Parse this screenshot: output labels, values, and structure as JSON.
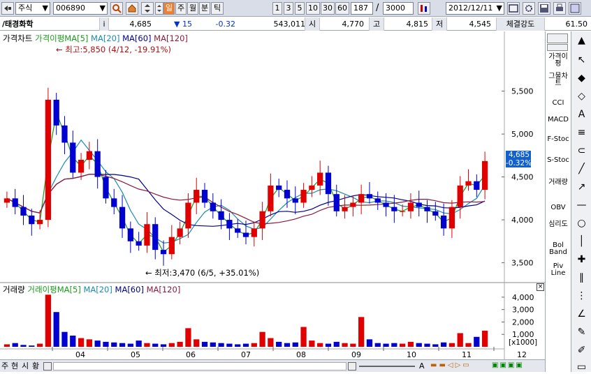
{
  "toolbar": {
    "market_select": "주식",
    "code_input": "006890",
    "period_buttons": [
      "일",
      "주",
      "월",
      "분",
      "틱"
    ],
    "interval_buttons": [
      "1",
      "3",
      "5",
      "10",
      "30",
      "60"
    ],
    "view_count": "187",
    "total_count": "3000",
    "date_input": "2012/12/11",
    "slash": "/"
  },
  "info": {
    "name": "/태경화학",
    "info_tag": "i",
    "price": "4,685",
    "change": "▼ 15",
    "change_pct": "-0.32",
    "volume": "543,011",
    "open_label": "시",
    "open": "4,770",
    "high_label": "고",
    "high": "4,815",
    "low_label": "저",
    "low": "4,545",
    "strength_label": "체결강도",
    "strength": "61.50"
  },
  "price_legend": {
    "prefix": "가격차트",
    "items": [
      {
        "name": "가격이평MA[5]",
        "color": "#1a9a1a"
      },
      {
        "name": "MA[20]",
        "color": "#1a8ab0"
      },
      {
        "name": "MA[60]",
        "color": "#00008b"
      },
      {
        "name": "MA[120]",
        "color": "#8b1a3a"
      }
    ]
  },
  "volume_legend": {
    "prefix": "거래량",
    "items": [
      {
        "name": "거래이평MA[5]",
        "color": "#1a9a1a"
      },
      {
        "name": "MA[20]",
        "color": "#1a8ab0"
      },
      {
        "name": "MA[60]",
        "color": "#00008b"
      },
      {
        "name": "MA[120]",
        "color": "#8b1a3a"
      }
    ]
  },
  "annotations": {
    "high": "← 최고:5,850 (4/12, -19.91%)",
    "low": "← 최저:3,470 (6/5, +35.01%)",
    "current_price": "4,685",
    "current_pct": "-0.32%",
    "volume_unit": "[x1000]"
  },
  "chart_data": [
    {
      "type": "candlestick",
      "title": "가격차트",
      "x_labels": [
        "04",
        "05",
        "06",
        "07",
        "08",
        "09",
        "10",
        "11",
        "12"
      ],
      "y_ticks": [
        "5,500",
        "5,000",
        "4,500",
        "4,000",
        "3,500"
      ],
      "y_tick_values": [
        5500,
        5000,
        4500,
        4000,
        3500
      ],
      "ylim": [
        3350,
        6050
      ],
      "highest": {
        "value": 5850,
        "date": "4/12"
      },
      "lowest": {
        "value": 3470,
        "date": "6/5"
      },
      "last_close": 4685,
      "closes": [
        4250,
        4150,
        4050,
        3950,
        4000,
        5400,
        5100,
        4900,
        4550,
        4700,
        4800,
        4500,
        4250,
        4150,
        3900,
        3750,
        3700,
        3950,
        3650,
        3600,
        3800,
        3900,
        4200,
        4350,
        4200,
        4100,
        4000,
        3900,
        3850,
        3800,
        3900,
        4100,
        4400,
        4350,
        4250,
        4200,
        4350,
        4400,
        4550,
        4300,
        4100,
        4150,
        4200,
        4300,
        4250,
        4200,
        4150,
        4100,
        4100,
        4200,
        4150,
        4100,
        4050,
        3900,
        4150,
        4400,
        4450,
        4350,
        4685
      ],
      "series": [
        {
          "name": "가격이평MA[5]",
          "color": "#1a9a1a"
        },
        {
          "name": "MA[20]",
          "color": "#1a8ab0"
        },
        {
          "name": "MA[60]",
          "color": "#00008b"
        },
        {
          "name": "MA[120]",
          "color": "#8b1a3a"
        }
      ]
    },
    {
      "type": "bar",
      "title": "거래량",
      "y_ticks": [
        "4,000",
        "3,000",
        "2,000",
        "1,000"
      ],
      "y_tick_values": [
        4000,
        3000,
        2000,
        1000
      ],
      "unit": "[x1000]",
      "ylim": [
        0,
        4500
      ],
      "values": [
        200,
        300,
        150,
        100,
        250,
        4200,
        2800,
        1200,
        900,
        700,
        600,
        500,
        400,
        350,
        300,
        250,
        500,
        300,
        250,
        200,
        300,
        400,
        1500,
        600,
        400,
        350,
        300,
        250,
        200,
        250,
        300,
        1200,
        700,
        400,
        300,
        350,
        1600,
        500,
        300,
        250,
        400,
        300,
        250,
        2400,
        600,
        300,
        250,
        300,
        250,
        400,
        300,
        250,
        200,
        350,
        300,
        1100,
        300,
        800,
        1300
      ]
    }
  ],
  "bottom": {
    "buttons": [
      "주",
      "현",
      "시",
      "황"
    ]
  },
  "right_tools": [
    "가격이평",
    "그물차트",
    "CCI",
    "MACD",
    "F-Stoc",
    "S-Stoc",
    "거래량",
    "OBV",
    "심리도",
    "Bol Band",
    "Piv Line"
  ]
}
